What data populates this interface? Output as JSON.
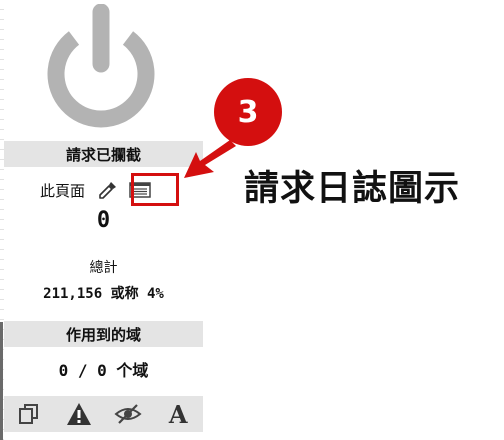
{
  "panel": {
    "blocked_header": "請求已攔截",
    "this_page_label": "此頁面",
    "this_page_count": "0",
    "total_label": "總計",
    "total_value": "211,156 或称 4%",
    "domains_header": "作用到的域",
    "domains_value": "0 / 0 个域"
  },
  "icons": {
    "power": "power-icon",
    "eyedropper": "eyedropper-icon",
    "request_log": "request-log-icon",
    "toolbar": [
      "copy-icon",
      "warning-icon",
      "eye-slash-icon",
      "font-icon"
    ]
  },
  "annotation": {
    "badge_number": "3",
    "label": "請求日誌圖示"
  },
  "colors": {
    "power_gray": "#b3b3b3",
    "header_bg": "#e4e4e4",
    "annotation_red": "#d40f0f"
  }
}
